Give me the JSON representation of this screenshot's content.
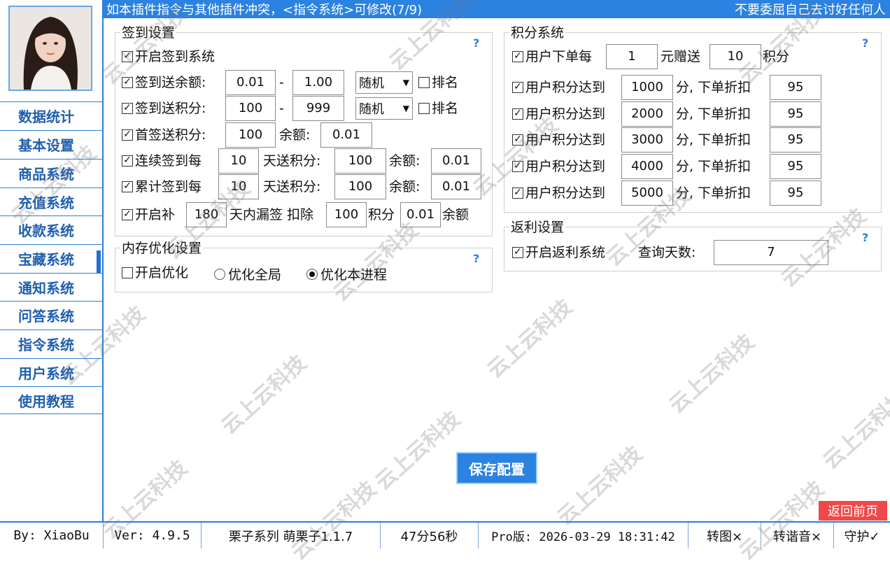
{
  "header": {
    "notice": "如本插件指令与其他插件冲突，<指令系统>可修改(7/9)",
    "motto": "不要委屈自己去讨好任何人"
  },
  "sidebar": {
    "items": [
      {
        "label": "数据统计"
      },
      {
        "label": "基本设置"
      },
      {
        "label": "商品系统"
      },
      {
        "label": "充值系统"
      },
      {
        "label": "收款系统"
      },
      {
        "label": "宝藏系统"
      },
      {
        "label": "通知系统"
      },
      {
        "label": "问答系统"
      },
      {
        "label": "指令系统"
      },
      {
        "label": "用户系统"
      },
      {
        "label": "使用教程"
      }
    ],
    "active": "宝藏系统"
  },
  "signin": {
    "title": "签到设置",
    "help": "?",
    "enable_label": "开启签到系统",
    "balance_label": "签到送余额:",
    "balance_min": "0.01",
    "balance_max": "1.00",
    "dash": "-",
    "balance_mode": "随机",
    "rank_label": "排名",
    "points_label": "签到送积分:",
    "points_min": "100",
    "points_max": "999",
    "points_mode": "随机",
    "first_label": "首签送积分:",
    "first_points": "100",
    "first_balance_label": "余额:",
    "first_balance": "0.01",
    "cont_label": "连续签到每",
    "cont_days": "10",
    "cont_points_label": "天送积分:",
    "cont_points": "100",
    "cont_balance_label": "余额:",
    "cont_balance": "0.01",
    "total_label": "累计签到每",
    "total_days": "10",
    "total_points_label": "天送积分:",
    "total_points": "100",
    "total_balance_label": "余额:",
    "total_balance": "0.01",
    "makeup_label": "开启补",
    "makeup_days": "180",
    "makeup_mid": "天内漏签 扣除",
    "makeup_points": "100",
    "makeup_points_label": "积分",
    "makeup_balance": "0.01",
    "makeup_balance_label": "余额"
  },
  "memory": {
    "title": "内存优化设置",
    "help": "?",
    "enable_label": "开启优化",
    "global_label": "优化全局",
    "process_label": "优化本进程"
  },
  "points": {
    "title": "积分系统",
    "help": "?",
    "order_label": "用户下单每",
    "order_amount": "1",
    "order_mid": "元赠送",
    "order_points": "10",
    "order_unit": "积分",
    "tiers": [
      {
        "label": "用户积分达到",
        "threshold": "1000",
        "mid": "分, 下单折扣",
        "discount": "95"
      },
      {
        "label": "用户积分达到",
        "threshold": "2000",
        "mid": "分, 下单折扣",
        "discount": "95"
      },
      {
        "label": "用户积分达到",
        "threshold": "3000",
        "mid": "分, 下单折扣",
        "discount": "95"
      },
      {
        "label": "用户积分达到",
        "threshold": "4000",
        "mid": "分, 下单折扣",
        "discount": "95"
      },
      {
        "label": "用户积分达到",
        "threshold": "5000",
        "mid": "分, 下单折扣",
        "discount": "95"
      }
    ]
  },
  "rebate": {
    "title": "返利设置",
    "help": "?",
    "enable_label": "开启返利系统",
    "days_label": "查询天数:",
    "days": "7"
  },
  "buttons": {
    "save": "保存配置",
    "back": "返回前页"
  },
  "status": {
    "author": "By: XiaoBu",
    "version": "Ver: 4.9.5",
    "product": "栗子系列 萌栗子1.1.7",
    "elapsed": "47分56秒",
    "license": "Pro版: 2026-03-29 18:31:42",
    "convert_img": "转图×",
    "convert_audio": "转谐音×",
    "guard": "守护✓"
  },
  "watermark": "云上云科技",
  "colors": {
    "accent": "#2b82e0",
    "danger": "#f04848"
  }
}
